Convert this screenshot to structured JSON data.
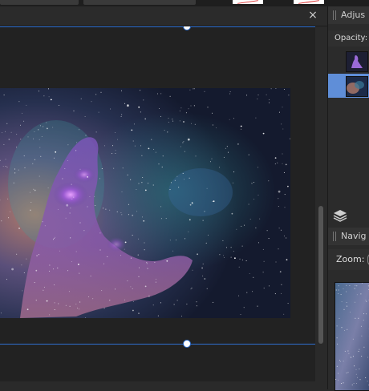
{
  "document": {
    "close_glyph": "×"
  },
  "panels": {
    "adjustments_tab_label": "Adjus",
    "opacity_label": "Opacity:",
    "navigator_tab_label": "Navig",
    "zoom_label": "Zoom:"
  },
  "layers": [
    {
      "name": "layer-mask-thumbnail"
    },
    {
      "name": "layer-galaxy-thumbnail",
      "selected": true
    }
  ],
  "colors": {
    "guide_blue": "#2f6fd0",
    "selection_blue": "#5f8ed8"
  }
}
